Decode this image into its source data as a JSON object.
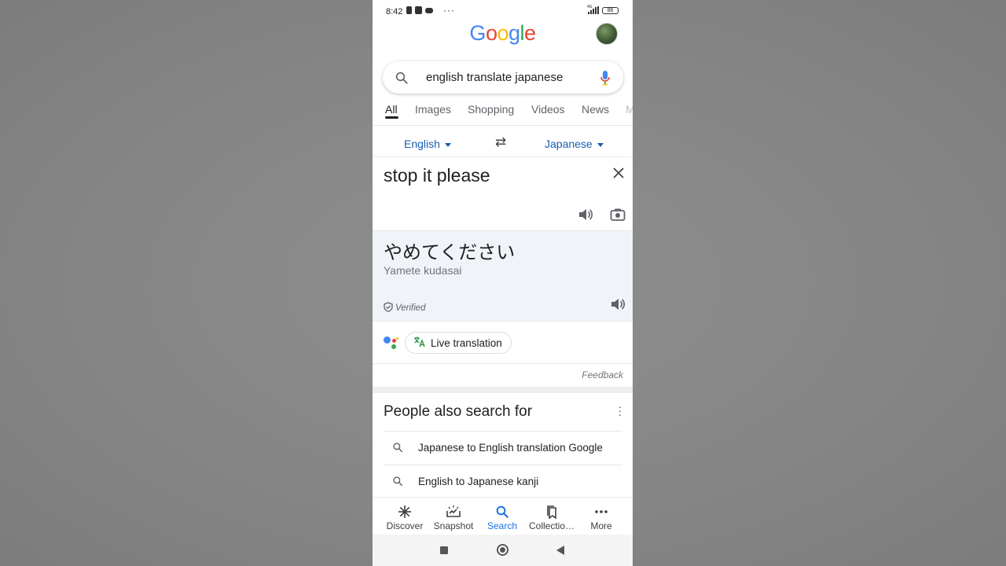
{
  "status_bar": {
    "time": "8:42",
    "more": "···",
    "network": "4G",
    "battery": "86"
  },
  "logo": {
    "letters": [
      "G",
      "o",
      "o",
      "g",
      "l",
      "e"
    ],
    "colors": [
      "#4285F4",
      "#EA4335",
      "#FBBC05",
      "#4285F4",
      "#34A853",
      "#EA4335"
    ]
  },
  "search": {
    "query": "english translate japanese"
  },
  "tabs": [
    "All",
    "Images",
    "Shopping",
    "Videos",
    "News",
    "M"
  ],
  "translator": {
    "source_lang": "English",
    "target_lang": "Japanese",
    "swap_icon": "⇄",
    "source_text": "stop it please",
    "result_text": "やめてください",
    "romanization": "Yamete kudasai",
    "verified": "Verified",
    "live_translation": "Live translation",
    "feedback": "Feedback"
  },
  "people_also_search": {
    "title": "People also search for",
    "items": [
      "Japanese to English translation Google",
      "English to Japanese kanji"
    ]
  },
  "bottom_nav": [
    {
      "label": "Discover",
      "icon": "asterisk-icon"
    },
    {
      "label": "Snapshot",
      "icon": "snapshot-icon"
    },
    {
      "label": "Search",
      "icon": "search-icon"
    },
    {
      "label": "Collectio…",
      "icon": "bookmarks-icon"
    },
    {
      "label": "More",
      "icon": "more-dots-icon"
    }
  ],
  "colors": {
    "accent_blue": "#1a73e8",
    "link_blue": "#1a5fb4",
    "result_bg": "#f0f4f8"
  }
}
